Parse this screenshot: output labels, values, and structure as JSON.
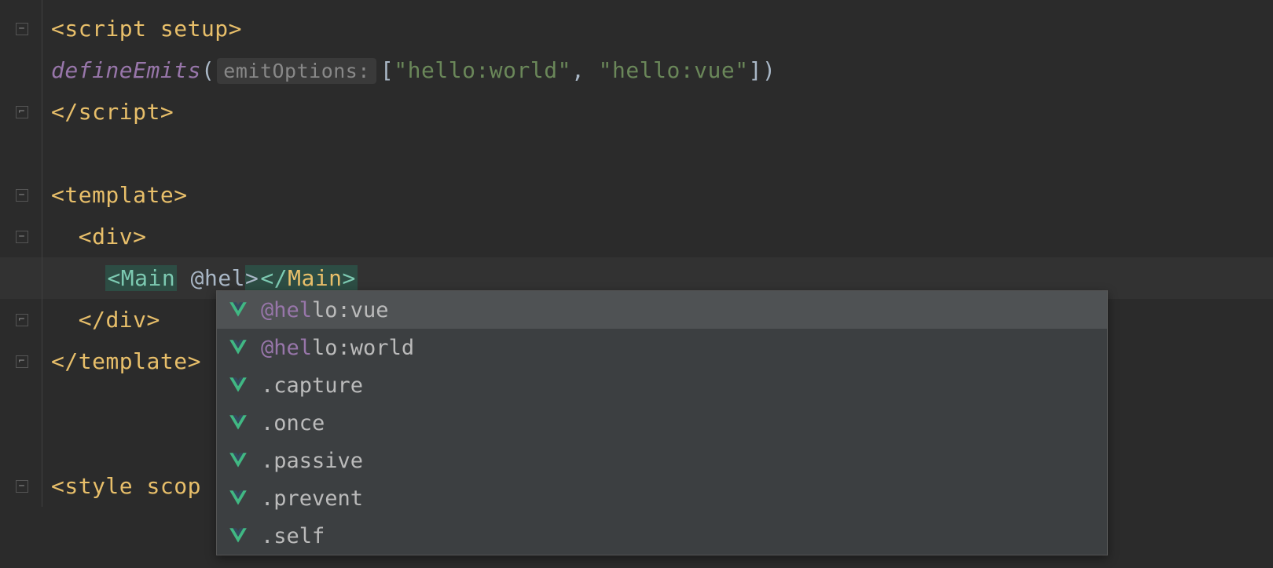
{
  "code": {
    "line1_open": "<",
    "line1_tag": "script",
    "line1_attr": " setup",
    "line1_close": ">",
    "line2_fn": "defineEmits",
    "line2_hint": "emitOptions:",
    "line2_arr_open": "[",
    "line2_str1": "\"hello:world\"",
    "line2_comma": ", ",
    "line2_str2": "\"hello:vue\"",
    "line2_arr_close": "]",
    "line3_open": "</",
    "line3_tag": "script",
    "line3_close": ">",
    "line5_open": "<",
    "line5_tag": "template",
    "line5_close": ">",
    "line6_open": "<",
    "line6_tag": "div",
    "line6_close": ">",
    "line7_main_open": "<",
    "line7_main": "Main",
    "line7_attr": " @hel",
    "line7_main_gt": ">",
    "line7_close_open": "</",
    "line7_close_tag": "Main",
    "line7_close_close": ">",
    "line8_open": "</",
    "line8_tag": "div",
    "line8_close": ">",
    "line9_open": "</",
    "line9_tag": "template",
    "line9_close": ">",
    "line13_open": "<",
    "line13_tag": "style",
    "line13_attr": " scop"
  },
  "completion": {
    "match_prefix": "@hel",
    "items": [
      {
        "prefix": "@hel",
        "rest": "lo:vue",
        "selected": true
      },
      {
        "prefix": "@hel",
        "rest": "lo:world",
        "selected": false
      },
      {
        "prefix": "",
        "rest": ".capture",
        "selected": false
      },
      {
        "prefix": "",
        "rest": ".once",
        "selected": false
      },
      {
        "prefix": "",
        "rest": ".passive",
        "selected": false
      },
      {
        "prefix": "",
        "rest": ".prevent",
        "selected": false
      },
      {
        "prefix": "",
        "rest": ".self",
        "selected": false
      }
    ]
  },
  "colors": {
    "background": "#2b2b2b",
    "popup": "#3c3f41",
    "selected": "#4f5254",
    "tag": "#e8bf6a",
    "string": "#6a8759",
    "fn": "#9876aa",
    "match": "#9876aa"
  }
}
